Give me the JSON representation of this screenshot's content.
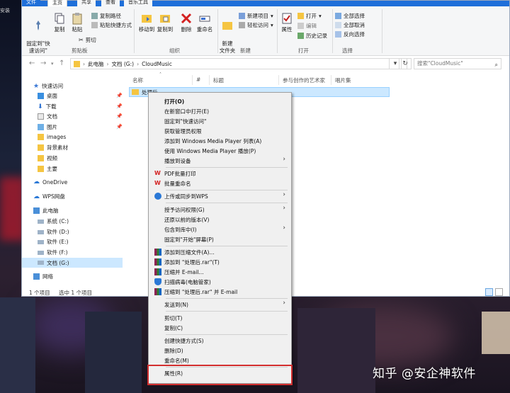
{
  "wallpaper": {
    "corner_text": "安装",
    "watermark": "知乎 @安企神软件"
  },
  "ribbon": {
    "tabs": [
      "文件",
      "主页",
      "共享",
      "查看",
      "音乐工具"
    ],
    "clipboard": {
      "pin_label": "固定到\"快\n速访问\"",
      "copy": "复制",
      "paste": "粘贴",
      "copy_path": "复制路径",
      "paste_shortcut": "粘贴快捷方式",
      "cut": "剪切",
      "group": "剪贴板"
    },
    "organize": {
      "move_to": "移动到",
      "copy_to": "复制到",
      "delete": "删除",
      "rename": "重命名",
      "group": "组织"
    },
    "new": {
      "new_folder": "新建\n文件夹",
      "new_item": "新建项目",
      "easy_access": "轻松访问",
      "group": "新建"
    },
    "open": {
      "properties": "属性",
      "open": "打开",
      "edit": "编辑",
      "history": "历史记录",
      "group": "打开"
    },
    "select": {
      "select_all": "全部选择",
      "select_none": "全部取消",
      "invert": "反向选择",
      "group": "选择"
    }
  },
  "address": {
    "crumbs": [
      "此电脑",
      "文档 (G:)",
      "CloudMusic"
    ],
    "search_placeholder": "搜索\"CloudMusic\""
  },
  "nav": {
    "quick_access": "快速访问",
    "items": [
      {
        "label": "桌面",
        "pinned": true
      },
      {
        "label": "下载",
        "pinned": true
      },
      {
        "label": "文档",
        "pinned": true
      },
      {
        "label": "图片",
        "pinned": true
      },
      {
        "label": "images",
        "pinned": false
      },
      {
        "label": "背景素材",
        "pinned": false
      },
      {
        "label": "视频",
        "pinned": false
      },
      {
        "label": "主要",
        "pinned": false
      }
    ],
    "onedrive": "OneDrive",
    "wps": "WPS网盘",
    "this_pc": "此电脑",
    "drives": [
      "系统 (C:)",
      "软件 (D:)",
      "软件 (E:)",
      "软件 (F:)",
      "文档 (G:)"
    ],
    "network": "网络"
  },
  "content": {
    "columns": [
      "名称",
      "#",
      "标题",
      "参与创作的艺术家",
      "唱片集"
    ],
    "selected_item": "处理后"
  },
  "status": {
    "count": "1 个项目",
    "selected": "选中 1 个项目"
  },
  "context_menu": {
    "items": [
      {
        "label": "打开(O)",
        "bold": true
      },
      {
        "label": "在新窗口中打开(E)"
      },
      {
        "label": "固定到\"快速访问\""
      },
      {
        "label": "获取管理员权限"
      },
      {
        "label": "添加到 Windows Media Player 列表(A)"
      },
      {
        "label": "使用 Windows Media Player 播放(P)"
      },
      {
        "label": "播放到设备",
        "submenu": true
      },
      {
        "label": "PDF批量打印",
        "icon": "wps-icon"
      },
      {
        "label": "批量重命名",
        "icon": "wps-icon"
      },
      {
        "label": "上传或同步到WPS",
        "icon": "wps-cloud-icon",
        "submenu": true
      },
      {
        "label": "授予访问权限(G)",
        "submenu": true
      },
      {
        "label": "还原以前的版本(V)"
      },
      {
        "label": "包含到库中(I)",
        "submenu": true
      },
      {
        "label": "固定到\"开始\"屏幕(P)"
      },
      {
        "label": "添加到压缩文件(A)...",
        "icon": "winrar-icon"
      },
      {
        "label": "添加到 \"处理后.rar\"(T)",
        "icon": "winrar-icon"
      },
      {
        "label": "压缩并 E-mail...",
        "icon": "winrar-icon"
      },
      {
        "label": "扫描病毒(电脑管家)",
        "icon": "shield-icon"
      },
      {
        "label": "压缩到 \"处理后.rar\" 并 E-mail",
        "icon": "winrar-icon"
      },
      {
        "label": "发送到(N)",
        "submenu": true
      },
      {
        "label": "剪切(T)"
      },
      {
        "label": "复制(C)"
      },
      {
        "label": "创建快捷方式(S)"
      },
      {
        "label": "删除(D)"
      },
      {
        "label": "重命名(M)"
      },
      {
        "label": "属性(R)"
      }
    ]
  },
  "colors": {
    "accent": "#1e6fd9",
    "selection": "#cce8ff",
    "highlight_box": "#d32f2f",
    "folder": "#f5c542"
  }
}
